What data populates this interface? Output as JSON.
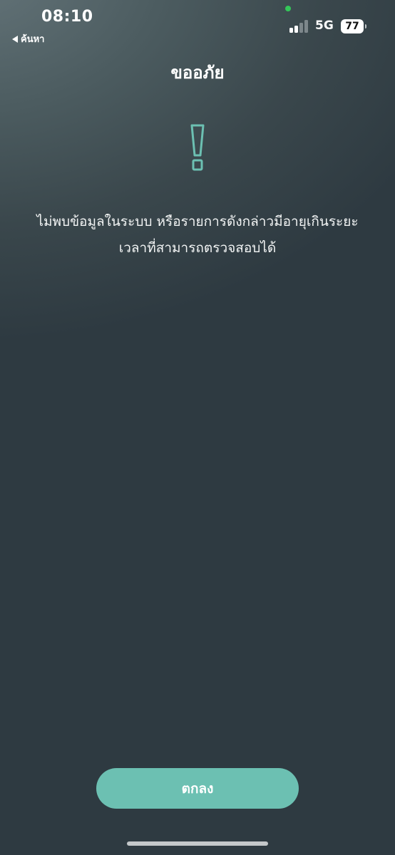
{
  "status_bar": {
    "time": "08:10",
    "back_label": "ค้นหา",
    "network": "5G",
    "battery": "77",
    "signal_bars_active": 2,
    "signal_bars_total": 4
  },
  "dialog": {
    "title": "ขออภัย",
    "icon": "exclamation-icon",
    "message_line_1": "ไม่พบข้อมูลในระบบ หรือรายการดังกล่าวมีอายุเกินระยะ",
    "message_line_2": "เวลาที่สามารถตรวจสอบได้",
    "ok_label": "ตกลง"
  },
  "colors": {
    "accent": "#6cc0b2",
    "icon": "#6cc0b2",
    "background": "#2e3a41",
    "status_dot": "#34c759"
  }
}
